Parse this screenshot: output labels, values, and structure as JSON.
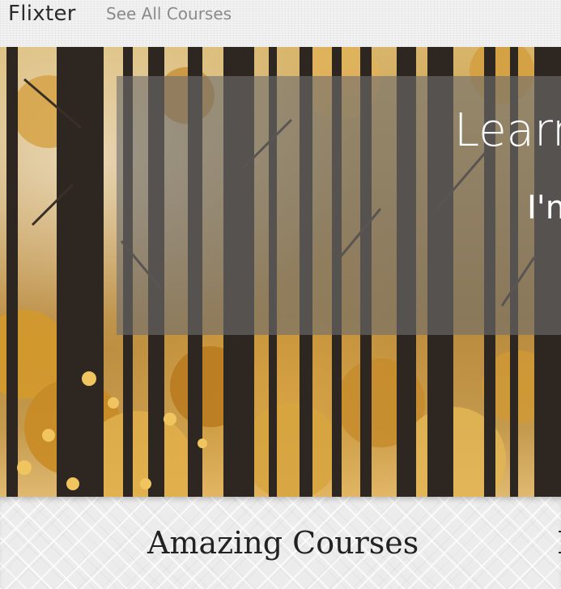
{
  "nav": {
    "brand": "Flixter",
    "links": [
      "See All Courses"
    ]
  },
  "hero": {
    "title": "Learn",
    "subtitle": "I'm"
  },
  "section": {
    "title": "Amazing Courses",
    "title_next": "L"
  },
  "colors": {
    "overlay": "#6e6e6e",
    "hero_text": "#ffffff",
    "brand_text": "#2b2b2b",
    "link_text": "#8a8a8a"
  }
}
